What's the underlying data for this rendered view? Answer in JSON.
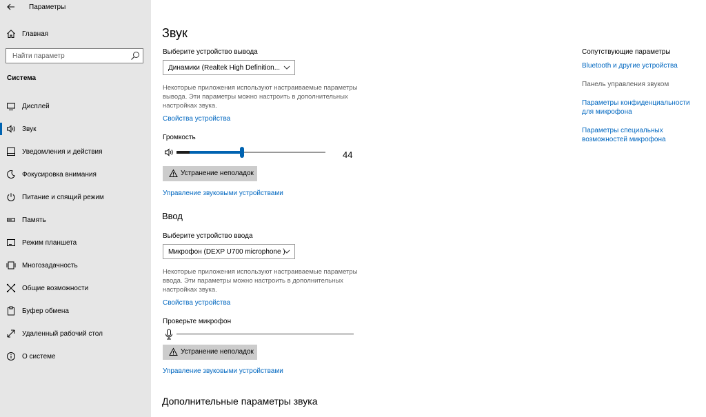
{
  "window": {
    "title": "Параметры",
    "minimize_glyph": "—",
    "maximize_glyph": "☐",
    "close_glyph": "✕"
  },
  "sidebar": {
    "home_label": "Главная",
    "search_placeholder": "Найти параметр",
    "section_label": "Система",
    "items": [
      {
        "label": "Дисплей",
        "icon": "display-icon",
        "selected": false
      },
      {
        "label": "Звук",
        "icon": "speaker-icon",
        "selected": true
      },
      {
        "label": "Уведомления и действия",
        "icon": "notifications-icon",
        "selected": false
      },
      {
        "label": "Фокусировка внимания",
        "icon": "moon-icon",
        "selected": false
      },
      {
        "label": "Питание и спящий режим",
        "icon": "power-icon",
        "selected": false
      },
      {
        "label": "Память",
        "icon": "storage-icon",
        "selected": false
      },
      {
        "label": "Режим планшета",
        "icon": "tablet-icon",
        "selected": false
      },
      {
        "label": "Многозадачность",
        "icon": "multitasking-icon",
        "selected": false
      },
      {
        "label": "Общие возможности",
        "icon": "shared-experiences-icon",
        "selected": false
      },
      {
        "label": "Буфер обмена",
        "icon": "clipboard-icon",
        "selected": false
      },
      {
        "label": "Удаленный рабочий стол",
        "icon": "remote-desktop-icon",
        "selected": false
      },
      {
        "label": "О системе",
        "icon": "info-icon",
        "selected": false
      }
    ]
  },
  "main": {
    "title": "Звук",
    "output": {
      "select_label": "Выберите устройство вывода",
      "device": "Динамики (Realtek High Definition...",
      "description": "Некоторые приложения используют настраиваемые параметры вывода. Эти параметры можно настроить в дополнительных настройках звука.",
      "properties_link": "Свойства устройства",
      "volume_label": "Громкость",
      "volume_value": "44",
      "volume_level": 44,
      "troubleshoot_label": "Устранение неполадок",
      "manage_link": "Управление звуковыми устройствами"
    },
    "input": {
      "heading": "Ввод",
      "select_label": "Выберите устройство ввода",
      "device": "Микрофон (DEXP U700 microphone )",
      "description": "Некоторые приложения используют настраиваемые параметры ввода. Эти параметры можно настроить в дополнительных настройках звука.",
      "properties_link": "Свойства устройства",
      "test_label": "Проверьте микрофон",
      "mic_level": 0,
      "troubleshoot_label": "Устранение неполадок",
      "manage_link": "Управление звуковыми устройствами"
    },
    "advanced_heading": "Дополнительные параметры звука"
  },
  "related": {
    "title": "Сопутствующие параметры",
    "items": [
      {
        "label": "Bluetooth и другие устройства",
        "link": true
      },
      {
        "label": "Панель управления звуком",
        "link": false
      },
      {
        "label": "Параметры конфиденциальности для микрофона",
        "link": true
      },
      {
        "label": "Параметры специальных возможностей микрофона",
        "link": true
      }
    ]
  },
  "colors": {
    "accent": "#0063b1",
    "link": "#0067c0",
    "sidebar_bg": "#e6e6e6"
  }
}
